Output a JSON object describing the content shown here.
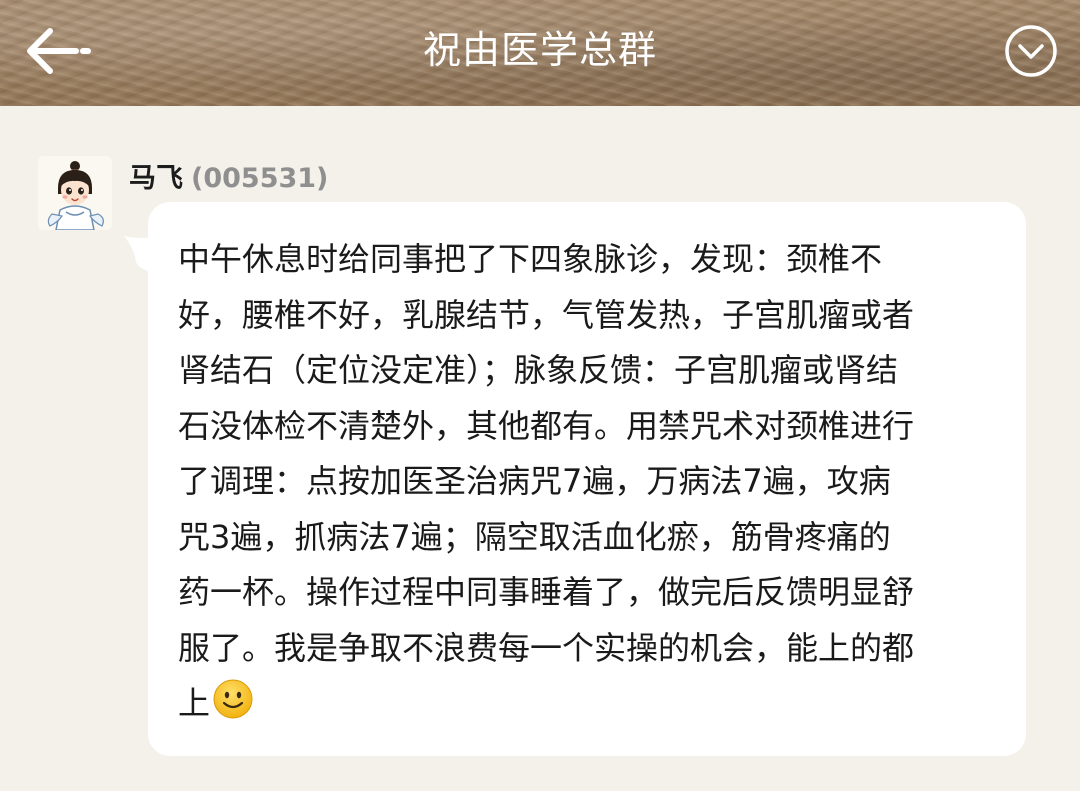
{
  "header": {
    "title": "祝由医学总群",
    "back_icon": "back-arrow-icon",
    "menu_icon": "chevron-down-circle-icon"
  },
  "message": {
    "sender_name": "马飞",
    "sender_id": "(005531)",
    "avatar_icon": "cartoon-avatar",
    "text_lines": [
      "中午休息时给同事把了下四象脉诊，发现：颈椎不",
      "好，腰椎不好，乳腺结节，气管发热，子宫肌瘤或者",
      "肾结石（定位没定准）；脉象反馈：子宫肌瘤或肾结",
      "石没体检不清楚外，其他都有。用禁咒术对颈椎进行",
      "了调理：点按加医圣治病咒7遍，万病法7遍，攻病",
      "咒3遍，抓病法7遍；隔空取活血化瘀，筋骨疼痛的",
      "药一杯。操作过程中同事睡着了，做完后反馈明显舒",
      "服了。我是争取不浪费每一个实操的机会，能上的都",
      "上"
    ],
    "trailing_emoji": "smiling-face-emoji"
  },
  "colors": {
    "header_bg": "#9b8063",
    "page_bg": "#f4f1ea",
    "bubble_bg": "#ffffff",
    "text": "#1a1a1a",
    "sender_id": "#8f8f8f",
    "emoji": "#f7c21b"
  }
}
